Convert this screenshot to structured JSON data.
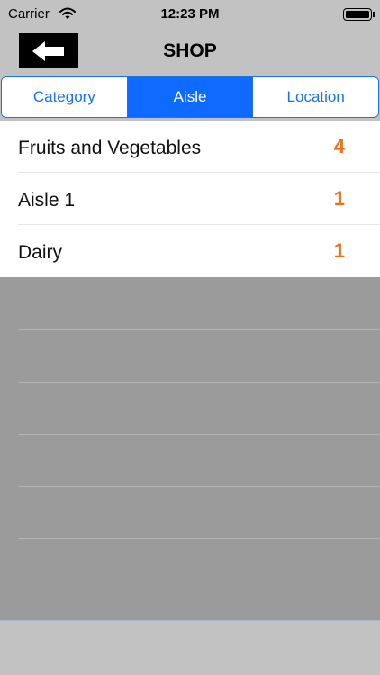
{
  "status_bar": {
    "carrier": "Carrier",
    "time": "12:23 PM"
  },
  "nav": {
    "title": "SHOP"
  },
  "segments": [
    {
      "label": "Category",
      "selected": false
    },
    {
      "label": "Aisle",
      "selected": true
    },
    {
      "label": "Location",
      "selected": false
    }
  ],
  "list": {
    "items": [
      {
        "label": "Fruits and Vegetables",
        "count": "4"
      },
      {
        "label": "Aisle 1",
        "count": "1"
      },
      {
        "label": "Dairy",
        "count": "1"
      }
    ]
  },
  "colors": {
    "accent": "#0f6bff",
    "count": "#e7731e",
    "bar_background": "#c2c2c2",
    "empty_area": "#9b9b9b"
  },
  "icons": {
    "back": "left-arrow-icon",
    "wifi": "wifi-icon",
    "battery": "battery-icon"
  }
}
